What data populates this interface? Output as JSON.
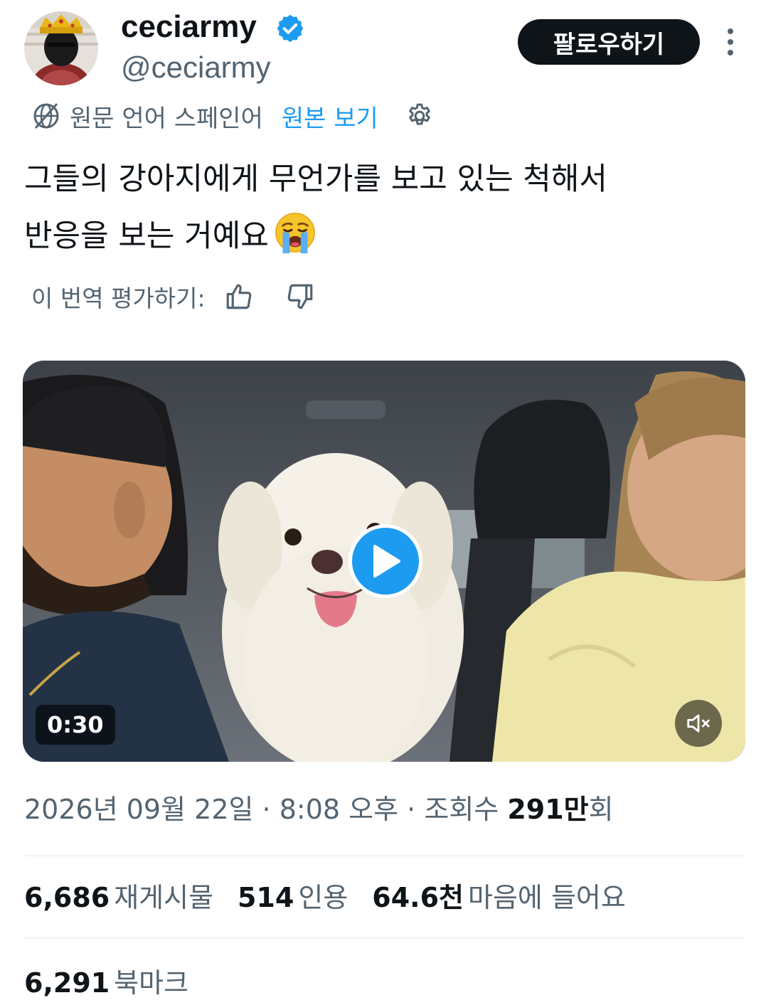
{
  "header": {
    "display_name": "ceciarmy",
    "handle": "@ceciarmy",
    "follow_label": "팔로우하기",
    "verified": true
  },
  "translation": {
    "source_language_label": "원문 언어 스페인어",
    "show_original_label": "원본 보기",
    "rate_label": "이 번역 평가하기:"
  },
  "tweet": {
    "line1": "그들의 강아지에게 무언가를 보고 있는 척해서",
    "line2": "반응을 보는 거예요",
    "emoji": "loudly-crying-face"
  },
  "media": {
    "duration": "0:30",
    "muted": true
  },
  "meta": {
    "date": "2026년 09월 22일",
    "separator": "·",
    "time": "8:08 오후",
    "views_prefix": "조회수",
    "views_count": "291만",
    "views_suffix": "회"
  },
  "stats": {
    "reposts_count": "6,686",
    "reposts_label": "재게시물",
    "quotes_count": "514",
    "quotes_label": "인용",
    "likes_count": "64.6천",
    "likes_label": "마음에 들어요",
    "bookmarks_count": "6,291",
    "bookmarks_label": "북마크"
  },
  "colors": {
    "text_primary": "#0f1419",
    "text_secondary": "#536471",
    "accent": "#1d9bf0",
    "follow_button_bg": "#0f1419",
    "divider": "#eff3f4"
  }
}
